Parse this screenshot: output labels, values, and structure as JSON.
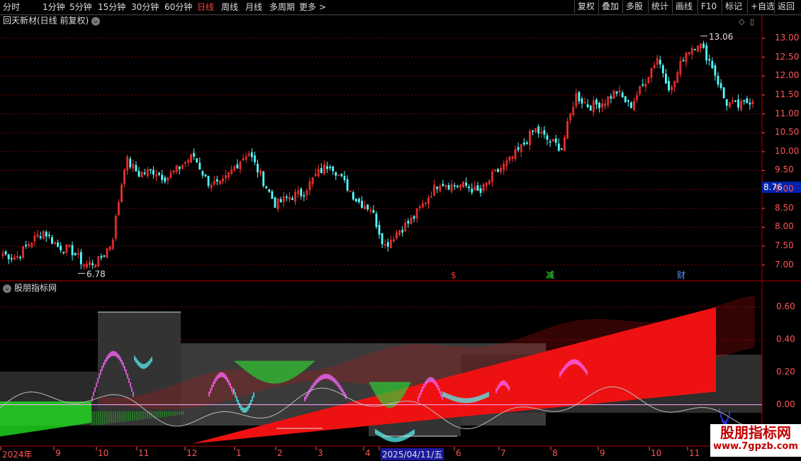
{
  "toolbar": {
    "periods": [
      "分时",
      "1分钟",
      "5分钟",
      "15分钟",
      "30分钟",
      "60分钟",
      "日线",
      "周线",
      "月线",
      "多周期",
      "更多 >"
    ],
    "active_period": "日线",
    "right_buttons": [
      "复权",
      "叠加",
      "多股",
      "统计",
      "画线",
      "F10",
      "标记",
      "+自选",
      "返回"
    ]
  },
  "main_chart": {
    "title": "回天新材(日线 前复权)",
    "y_ticks": [
      "13.00",
      "12.50",
      "12.00",
      "11.50",
      "11.00",
      "10.50",
      "10.00",
      "9.50",
      "9.00",
      "8.50",
      "8.00",
      "7.50",
      "7.00"
    ],
    "current_price": "8.76",
    "high_label": "13.06",
    "low_label": "6.78",
    "event_markers": [
      "$",
      "减",
      "财"
    ]
  },
  "sub_chart": {
    "title": "股朋指标网",
    "y_ticks": [
      "0.60",
      "0.40",
      "0.20",
      "0.00"
    ]
  },
  "date_axis": {
    "labels": [
      "2024年",
      "9",
      "10",
      "11",
      "12",
      "1",
      "2",
      "3",
      "4",
      "2025/04/11/五",
      "6",
      "7",
      "8",
      "9",
      "10",
      "11"
    ]
  },
  "watermark": {
    "line1": "股朋指标网",
    "line2": "www.7gpzb.com"
  },
  "colors": {
    "up": "#ff3333",
    "down": "#54ffff",
    "grid": "#7a0000",
    "axis": "#ff5555"
  },
  "chart_data": {
    "type": "candlestick",
    "price_range": [
      6.78,
      13.06
    ],
    "price_ylim": [
      6.6,
      13.3
    ],
    "indicator_ylim": [
      -0.25,
      0.7
    ],
    "close_series_approx": [
      7.3,
      7.2,
      7.6,
      7.9,
      7.5,
      7.4,
      7.0,
      7.1,
      7.6,
      9.8,
      9.4,
      9.5,
      9.3,
      9.6,
      9.9,
      9.2,
      9.1,
      9.6,
      10.0,
      9.3,
      8.6,
      8.8,
      8.9,
      9.4,
      9.7,
      9.2,
      8.7,
      8.5,
      7.5,
      7.9,
      8.2,
      8.7,
      9.2,
      9.1,
      9.1,
      8.9,
      9.4,
      9.7,
      10.1,
      10.6,
      10.3,
      10.1,
      11.5,
      11.2,
      11.3,
      11.6,
      11.2,
      11.8,
      12.5,
      11.6,
      12.6,
      12.9,
      12.3,
      11.3,
      11.2,
      11.4
    ]
  }
}
